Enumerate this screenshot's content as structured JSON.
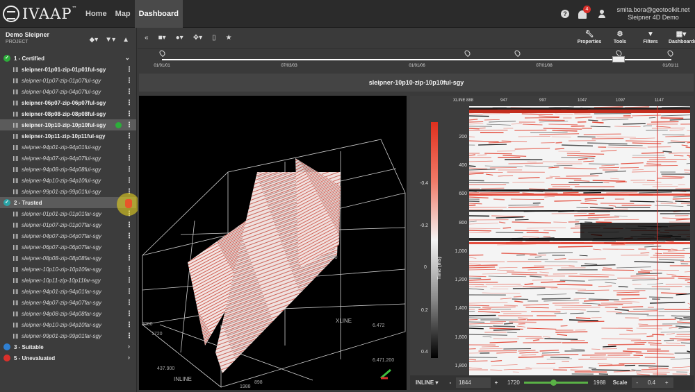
{
  "app": {
    "logo_text": "IVAAP",
    "logo_tm": "™",
    "nav": [
      {
        "label": "Home"
      },
      {
        "label": "Map"
      },
      {
        "label": "Dashboard",
        "active": true
      }
    ],
    "notifications_count": "4",
    "user_email": "smita.bora@geotoolkit.net",
    "user_project": "Sleipner 4D Demo",
    "help_glyph": "?"
  },
  "project": {
    "name": "Demo Sleipner",
    "subtitle": "PROJECT"
  },
  "groups": [
    {
      "label": "1 - Certified",
      "status_color": "#2cae3a",
      "glyph": "✓"
    },
    {
      "label": "2 - Trusted",
      "status_color": "#2aa3a6",
      "glyph": "✓"
    },
    {
      "label": "3 - Suitable",
      "status_color": "#2f7fd1",
      "glyph": ""
    },
    {
      "label": "5 - Unevaluated",
      "status_color": "#d9302b",
      "glyph": ""
    }
  ],
  "certified_items": [
    {
      "label": "sleipner-01p01-zip-01p01ful-sgy",
      "style": "bold"
    },
    {
      "label": "sleipner-01p07-zip-01p07ful-sgy",
      "style": "italic"
    },
    {
      "label": "sleipner-04p07-zip-04p07ful-sgy",
      "style": "italic"
    },
    {
      "label": "sleipner-06p07-zip-06p07ful-sgy",
      "style": "bold"
    },
    {
      "label": "sleipner-08p08-zip-08p08ful-sgy",
      "style": "bold"
    },
    {
      "label": "sleipner-10p10-zip-10p10ful-sgy",
      "style": "bold",
      "selected": true
    },
    {
      "label": "sleipner-10p11-zip-10p11ful-sgy",
      "style": "bold"
    },
    {
      "label": "sleipner-94p01-zip-94p01ful-sgy",
      "style": "italic"
    },
    {
      "label": "sleipner-94p07-zip-94p07ful-sgy",
      "style": "italic"
    },
    {
      "label": "sleipner-94p08-zip-94p08ful-sgy",
      "style": "italic"
    },
    {
      "label": "sleipner-94p10-zip-94p10ful-sgy",
      "style": "italic"
    },
    {
      "label": "sleipner-99p01-zip-99p01ful-sgy",
      "style": "italic"
    }
  ],
  "trusted_items": [
    {
      "label": "sleipner-01p01-zip-01p01far-sgy"
    },
    {
      "label": "sleipner-01p07-zip-01p07far-sgy"
    },
    {
      "label": "sleipner-04p07-zip-04p07far-sgy"
    },
    {
      "label": "sleipner-06p07-zip-06p07far-sgy"
    },
    {
      "label": "sleipner-08p08-zip-08p08far-sgy"
    },
    {
      "label": "sleipner-10p10-zip-10p10far-sgy"
    },
    {
      "label": "sleipner-10p11-zip-10p11far-sgy"
    },
    {
      "label": "sleipner-94p01-zip-94p01far-sgy"
    },
    {
      "label": "sleipner-94p07-zip-94p07far-sgy"
    },
    {
      "label": "sleipner-94p08-zip-94p08far-sgy"
    },
    {
      "label": "sleipner-94p10-zip-94p10far-sgy"
    },
    {
      "label": "sleipner-99p01-zip-99p01far-sgy"
    }
  ],
  "toolbar": {
    "buttons": [
      {
        "label": "Properties",
        "icon": "wrench-icon"
      },
      {
        "label": "Tools",
        "icon": "tools-icon"
      },
      {
        "label": "Filters",
        "icon": "filter-icon"
      },
      {
        "label": "Dashboards",
        "icon": "grid-icon"
      }
    ]
  },
  "timeline": {
    "labels": [
      "01/01/01",
      "07/03/03",
      "01/01/06",
      "07/01/08",
      "01/01/11"
    ]
  },
  "viewer_title": "sleipner-10p10-zip-10p10ful-sgy",
  "view3d": {
    "ticks": [
      "1450",
      "XLINE",
      "2000",
      "1720",
      "6.472",
      "437.900",
      "INLINE",
      "898",
      "1988",
      "6.471.200"
    ]
  },
  "section": {
    "colorbar_title": "Time (ms)",
    "colorbar_ticks": [
      "-0.4",
      "-0.2",
      "0",
      "0.2",
      "0.4"
    ],
    "xline_label": "XLINE 888",
    "x_ticks": [
      "947",
      "997",
      "1047",
      "1097",
      "1147"
    ],
    "y_ticks": [
      "200",
      "400",
      "600",
      "800",
      "1,000",
      "1,200",
      "1,400",
      "1,600",
      "1,800"
    ],
    "colors": {
      "positive": "#e0301e",
      "negative": "#000000",
      "zero": "#f4f4f4"
    }
  },
  "bottombar": {
    "mode": "INLINE",
    "mode_arrow": "▾",
    "minus": "-",
    "plus": "+",
    "inline_value": "1844",
    "range_min": "1720",
    "range_max": "1988",
    "slider_fraction": 0.43,
    "scale_label": "Scale",
    "scale_value": "0.4"
  }
}
